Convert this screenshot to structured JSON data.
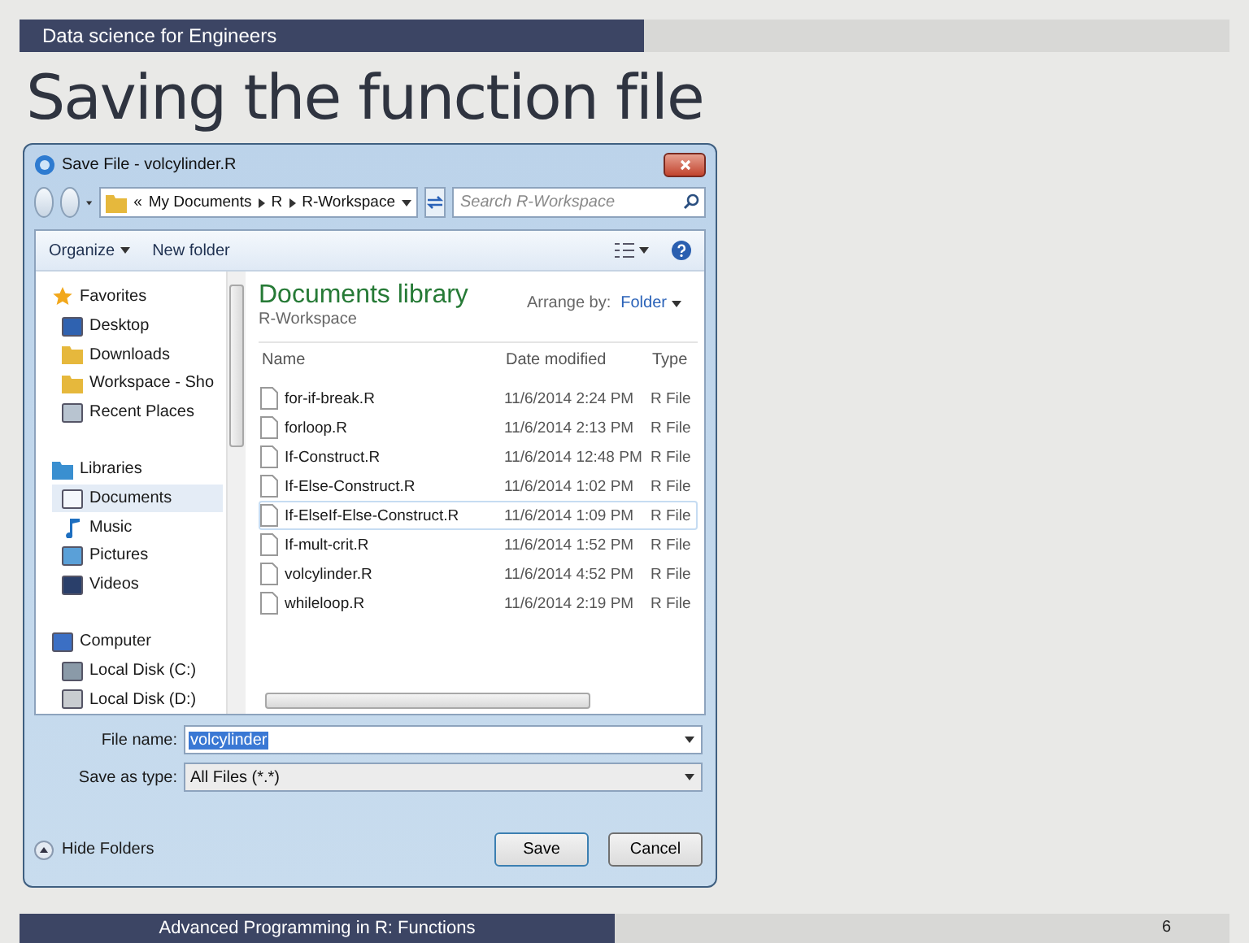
{
  "slide": {
    "header": "Data science for Engineers",
    "title": "Saving the function file",
    "footer": "Advanced Programming in R: Functions",
    "page_number": "6"
  },
  "dialog": {
    "title": "Save File - volcylinder.R",
    "breadcrumb": [
      "«",
      "My Documents",
      "R",
      "R-Workspace"
    ],
    "search": {
      "placeholder": "Search R-Workspace"
    },
    "toolbar": [
      "Organize",
      "New folder"
    ],
    "sidebar": [
      {
        "label": "Favorites",
        "selected": false,
        "children": [
          {
            "label": "Desktop",
            "selected": false
          },
          {
            "label": "Downloads",
            "selected": false
          },
          {
            "label": "Workspace - Sho",
            "selected": false
          },
          {
            "label": "Recent Places",
            "selected": false
          }
        ]
      },
      {
        "label": "Libraries",
        "selected": false,
        "children": [
          {
            "label": "Documents",
            "selected": true
          },
          {
            "label": "Music",
            "selected": false
          },
          {
            "label": "Pictures",
            "selected": false
          },
          {
            "label": "Videos",
            "selected": false
          }
        ]
      },
      {
        "label": "Computer",
        "selected": false,
        "children": [
          {
            "label": "Local Disk (C:)",
            "selected": false
          },
          {
            "label": "Local Disk (D:)",
            "selected": false
          }
        ]
      }
    ],
    "library": {
      "title": "Documents library",
      "subtitle": "R-Workspace",
      "arrange_label": "Arrange by:",
      "arrange_value": "Folder"
    },
    "columns": [
      "Name",
      "Date modified",
      "Type"
    ],
    "files": [
      {
        "name": "for-if-break.R",
        "date": "11/6/2014 2:24 PM",
        "type": "R File",
        "selected": false
      },
      {
        "name": "forloop.R",
        "date": "11/6/2014 2:13 PM",
        "type": "R File",
        "selected": false
      },
      {
        "name": "If-Construct.R",
        "date": "11/6/2014 12:48 PM",
        "type": "R File",
        "selected": false
      },
      {
        "name": "If-Else-Construct.R",
        "date": "11/6/2014 1:02 PM",
        "type": "R File",
        "selected": false
      },
      {
        "name": "If-ElseIf-Else-Construct.R",
        "date": "11/6/2014 1:09 PM",
        "type": "R File",
        "selected": true
      },
      {
        "name": "If-mult-crit.R",
        "date": "11/6/2014 1:52 PM",
        "type": "R File",
        "selected": false
      },
      {
        "name": "volcylinder.R",
        "date": "11/6/2014 4:52 PM",
        "type": "R File",
        "selected": false
      },
      {
        "name": "whileloop.R",
        "date": "11/6/2014 2:19 PM",
        "type": "R File",
        "selected": false
      }
    ],
    "file_name": {
      "label": "File name:",
      "value": "volcylinder"
    },
    "save_as_type": {
      "label": "Save as type:",
      "value": "All Files (*.*)"
    },
    "hide_folders": "Hide Folders",
    "buttons": [
      "Save",
      "Cancel"
    ]
  }
}
